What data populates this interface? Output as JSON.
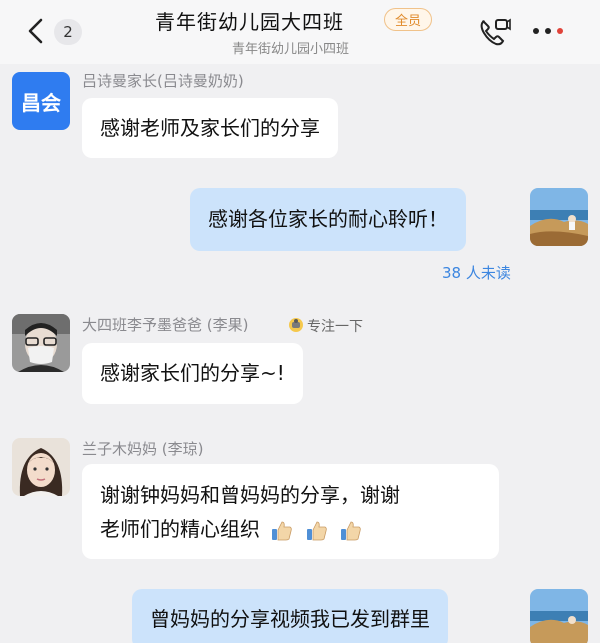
{
  "header": {
    "unread_badge": "2",
    "title": "青年街幼儿园大四班",
    "member_tag": "全员",
    "subtitle": "青年街幼儿园小四班"
  },
  "messages": [
    {
      "sender": "吕诗曼家长(吕诗曼奶奶)",
      "avatar_text": "昌会",
      "text": "感谢老师及家长们的分享"
    },
    {
      "text": "感谢各位家长的耐心聆听！",
      "read_status": "38 人未读"
    },
    {
      "sender": "大四班李予墨爸爸 (李果)",
      "status_note": "专注一下",
      "text": "感谢家长们的分享~!"
    },
    {
      "sender": "兰子木妈妈 (李琼)",
      "text_line1": "谢谢钟妈妈和曾妈妈的分享，谢谢",
      "text_line2": "老师们的精心组织"
    },
    {
      "text": "曾妈妈的分享视频我已发到群里"
    }
  ],
  "colors": {
    "accent_blue": "#2f7cf0",
    "outgoing_bubble": "#cce3fb",
    "read_status": "#3c86e0",
    "member_tag": "#e08a2a"
  }
}
